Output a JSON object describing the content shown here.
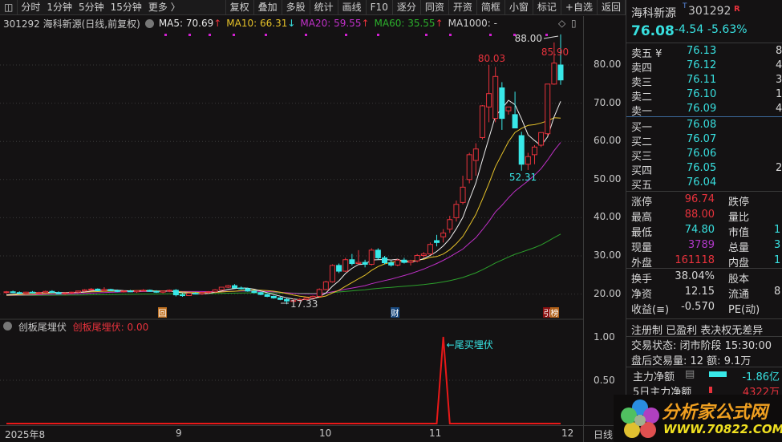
{
  "toolbar": {
    "left": [
      "分时",
      "1分钟",
      "5分钟",
      "15分钟",
      "更多 〉"
    ],
    "right": [
      "复权",
      "叠加",
      "多股",
      "统计",
      "画线",
      "F10",
      "逐分",
      "同资",
      "开资",
      "简框",
      "小窗",
      "标记",
      "+自选",
      "返回"
    ]
  },
  "info": {
    "title": "301292 海科新源(日线,前复权)",
    "ma5": "MA5: 70.69",
    "ma10": "MA10: 66.31",
    "ma20": "MA20: 59.55",
    "ma60": "MA60: 35.55",
    "ma1000": "MA1000: -",
    "arrow_up": "↑",
    "arrow_down": "↓"
  },
  "colors": {
    "up": "#e8323c",
    "down": "#38e8e8",
    "ma5": "#f0f0f0",
    "ma10": "#e6c229",
    "ma20": "#c030c8",
    "ma60": "#2ca02c"
  },
  "chart_data": {
    "type": "candlestick",
    "price_ticks": [
      "80.00",
      "70.00",
      "60.00",
      "50.00",
      "40.00",
      "30.00",
      "20.00"
    ],
    "price_values": [
      80,
      70,
      60,
      50,
      40,
      30,
      20
    ],
    "annotations": {
      "high": "88.00",
      "peak1": "80.03",
      "peak2": "85.90",
      "low": "52.31",
      "bottom": "17.33"
    },
    "markers": [
      "回",
      "财",
      "引",
      "榜"
    ],
    "ohlc": [
      [
        20.4,
        20.8,
        20.1,
        20.6
      ],
      [
        20.6,
        20.9,
        20.3,
        20.4
      ],
      [
        20.4,
        20.7,
        20.0,
        20.2
      ],
      [
        20.2,
        20.6,
        19.9,
        20.5
      ],
      [
        20.5,
        20.8,
        20.2,
        20.3
      ],
      [
        20.3,
        20.6,
        20.0,
        20.4
      ],
      [
        20.4,
        20.9,
        20.2,
        20.7
      ],
      [
        20.7,
        21.0,
        20.3,
        20.4
      ],
      [
        20.4,
        20.7,
        20.0,
        20.1
      ],
      [
        20.1,
        20.5,
        19.8,
        20.3
      ],
      [
        20.3,
        20.6,
        20.0,
        20.5
      ],
      [
        20.5,
        20.9,
        20.3,
        20.8
      ],
      [
        20.8,
        21.3,
        20.6,
        21.1
      ],
      [
        21.1,
        21.6,
        20.9,
        21.3
      ],
      [
        21.3,
        21.5,
        20.8,
        20.9
      ],
      [
        20.9,
        21.8,
        20.7,
        21.2
      ],
      [
        21.2,
        21.4,
        20.8,
        20.9
      ],
      [
        20.9,
        21.2,
        20.5,
        20.7
      ],
      [
        20.7,
        21.0,
        20.4,
        20.8
      ],
      [
        20.8,
        21.1,
        20.5,
        20.6
      ],
      [
        20.6,
        21.0,
        20.3,
        20.9
      ],
      [
        20.9,
        21.3,
        20.7,
        21.0
      ],
      [
        21.0,
        21.2,
        20.6,
        20.7
      ],
      [
        20.7,
        21.0,
        20.3,
        20.5
      ],
      [
        20.5,
        20.9,
        20.2,
        20.8
      ],
      [
        20.8,
        21.2,
        20.5,
        21.0
      ],
      [
        21.0,
        21.3,
        19.4,
        19.8
      ],
      [
        19.8,
        20.2,
        19.3,
        19.6
      ],
      [
        19.6,
        20.4,
        19.5,
        20.2
      ],
      [
        20.2,
        20.5,
        19.9,
        20.1
      ],
      [
        20.1,
        20.6,
        19.8,
        20.4
      ],
      [
        20.4,
        20.8,
        20.1,
        20.6
      ],
      [
        20.6,
        21.3,
        20.4,
        21.1
      ],
      [
        21.1,
        21.9,
        21.0,
        21.8
      ],
      [
        21.8,
        22.4,
        21.6,
        22.2
      ],
      [
        22.2,
        22.6,
        21.5,
        21.6
      ],
      [
        21.6,
        22.0,
        21.2,
        21.4
      ],
      [
        21.4,
        21.7,
        20.6,
        20.8
      ],
      [
        20.8,
        21.0,
        20.2,
        20.4
      ],
      [
        20.4,
        20.6,
        19.7,
        19.9
      ],
      [
        19.9,
        20.1,
        19.2,
        19.4
      ],
      [
        19.4,
        19.6,
        18.8,
        19.0
      ],
      [
        19.0,
        19.3,
        18.4,
        18.6
      ],
      [
        18.6,
        19.0,
        17.33,
        18.2
      ],
      [
        18.2,
        18.8,
        17.8,
        18.3
      ],
      [
        18.3,
        18.9,
        17.9,
        18.6
      ],
      [
        18.6,
        19.2,
        18.4,
        19.0
      ],
      [
        19.0,
        19.6,
        18.8,
        19.4
      ],
      [
        19.4,
        21.5,
        19.2,
        21.2
      ],
      [
        21.2,
        23.5,
        21.0,
        23.2
      ],
      [
        23.2,
        27.8,
        23.0,
        27.5
      ],
      [
        27.5,
        28.0,
        25.5,
        26.0
      ],
      [
        26.0,
        29.5,
        25.8,
        29.0
      ],
      [
        29.0,
        30.5,
        27.5,
        28.0
      ],
      [
        28.0,
        31.5,
        27.8,
        28.3
      ],
      [
        28.3,
        29.0,
        27.0,
        27.8
      ],
      [
        27.8,
        32.0,
        27.5,
        31.5
      ],
      [
        31.5,
        32.0,
        29.0,
        29.5
      ],
      [
        29.5,
        30.0,
        27.8,
        28.2
      ],
      [
        28.2,
        28.8,
        27.2,
        27.6
      ],
      [
        27.6,
        29.2,
        27.3,
        28.9
      ],
      [
        28.9,
        29.5,
        28.0,
        28.3
      ],
      [
        28.3,
        29.0,
        27.5,
        28.7
      ],
      [
        28.7,
        30.5,
        28.3,
        30.1
      ],
      [
        30.1,
        31.0,
        29.5,
        30.5
      ],
      [
        30.5,
        33.5,
        30.2,
        33.0
      ],
      [
        34.0,
        35.5,
        32.5,
        33.5
      ],
      [
        35.0,
        37.0,
        33.5,
        36.0
      ],
      [
        37.0,
        40.5,
        36.0,
        39.5
      ],
      [
        40.0,
        44.5,
        39.0,
        43.5
      ],
      [
        44.0,
        51.0,
        43.5,
        48.0
      ],
      [
        50.0,
        57.0,
        49.0,
        56.5
      ],
      [
        55.0,
        59.5,
        51.0,
        58.0
      ],
      [
        61.0,
        69.5,
        60.5,
        69.3
      ],
      [
        69.0,
        80.03,
        65.0,
        72.5
      ],
      [
        66.0,
        79.5,
        65.0,
        77.0
      ],
      [
        74.0,
        75.5,
        63.0,
        66.0
      ],
      [
        68.0,
        69.0,
        67.0,
        69.0
      ],
      [
        67.0,
        73.0,
        63.5,
        63.5
      ],
      [
        61.5,
        62.5,
        52.31,
        54.0
      ],
      [
        54.0,
        57.0,
        52.5,
        56.0
      ],
      [
        56.5,
        59.0,
        54.0,
        58.5
      ],
      [
        59.0,
        62.0,
        58.5,
        62.3
      ],
      [
        62.0,
        67.0,
        61.5,
        75.0
      ],
      [
        75.0,
        85.9,
        74.8,
        80.5
      ],
      [
        80.0,
        88.0,
        74.8,
        76.08
      ]
    ],
    "x_ticks": [
      "2025年8",
      "9",
      "10",
      "11",
      "12"
    ],
    "indicator": {
      "name": "创板尾埋伏",
      "value_label": "创板尾埋伏: 0.00",
      "signal_label": "←尾买埋伏",
      "signal_index": 67,
      "ticks": [
        "1.00",
        "0.50"
      ]
    }
  },
  "period": "日线",
  "quote": {
    "name": "海科新源",
    "tag": "T",
    "code": "301292",
    "badge": "R",
    "price": "76.08",
    "change": "-4.54",
    "pct": "-5.63%"
  },
  "asks": [
    {
      "l": "卖五 ¥",
      "p": "76.13",
      "v": "8"
    },
    {
      "l": "卖四",
      "p": "76.12",
      "v": "4"
    },
    {
      "l": "卖三",
      "p": "76.11",
      "v": "3"
    },
    {
      "l": "卖二",
      "p": "76.10",
      "v": "1"
    },
    {
      "l": "卖一",
      "p": "76.09",
      "v": "4"
    }
  ],
  "bids": [
    {
      "l": "买一",
      "p": "76.08",
      "v": ""
    },
    {
      "l": "买二",
      "p": "76.07",
      "v": ""
    },
    {
      "l": "买三",
      "p": "76.06",
      "v": ""
    },
    {
      "l": "买四",
      "p": "76.05",
      "v": "2"
    },
    {
      "l": "买五",
      "p": "76.04",
      "v": ""
    }
  ],
  "stats1": [
    {
      "l": "涨停",
      "v": "96.74",
      "c": "rd",
      "l2": "跌停",
      "v2": ""
    },
    {
      "l": "最高",
      "v": "88.00",
      "c": "rd",
      "l2": "量比",
      "v2": ""
    },
    {
      "l": "最低",
      "v": "74.80",
      "c": "cy",
      "l2": "市值",
      "v2": "1"
    },
    {
      "l": "现量",
      "v": "3789",
      "c": "mg",
      "l2": "总量",
      "v2": "3"
    },
    {
      "l": "外盘",
      "v": "161118",
      "c": "rd",
      "l2": "内盘",
      "v2": "1"
    }
  ],
  "stats2": [
    {
      "l": "换手",
      "v": "38.04%",
      "l2": "股本",
      "v2": ""
    },
    {
      "l": "净资",
      "v": "12.15",
      "l2": "流通",
      "v2": "8"
    },
    {
      "l": "收益(≡)",
      "v": "-0.570",
      "l2": "PE(动)",
      "v2": ""
    }
  ],
  "tags": "注册制 已盈利 表决权无差异",
  "status": "交易状态: 闭市阶段 15:30:00",
  "after": "盘后交易量: 12  额: 9.1万",
  "flow": [
    {
      "l": "主力净额",
      "v": "-1.86亿",
      "c": "cy"
    },
    {
      "l": "5日主力净额",
      "v": "4322万",
      "c": "rd"
    }
  ],
  "watermark": {
    "cn": "分析家公式网",
    "url": "WWW.70822.COM"
  }
}
